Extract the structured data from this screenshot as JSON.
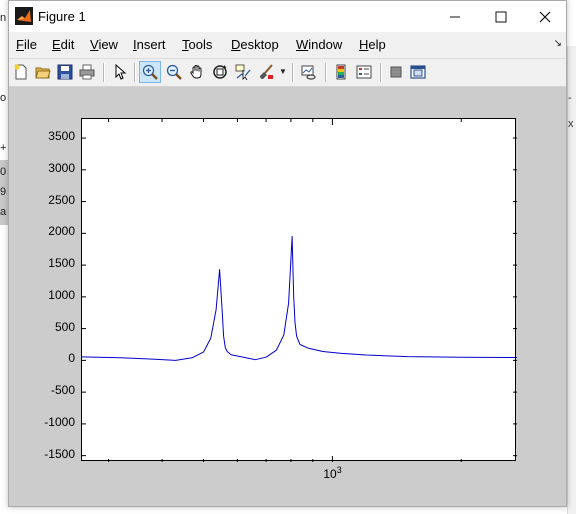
{
  "window": {
    "title": "Figure 1",
    "controls": {
      "minimize": "minimize",
      "maximize": "maximize",
      "close": "close"
    }
  },
  "menu": {
    "items": [
      "File",
      "Edit",
      "View",
      "Insert",
      "Tools",
      "Desktop",
      "Window",
      "Help"
    ],
    "overflow_arrow": "↘"
  },
  "toolbar": {
    "buttons": [
      "new-figure-icon",
      "open-file-icon",
      "save-icon",
      "print-icon",
      "edit-plot-arrow-icon",
      "zoom-in-icon",
      "zoom-out-icon",
      "pan-hand-icon",
      "rotate-3d-icon",
      "data-cursor-icon",
      "brush-icon",
      "link-plot-icon",
      "colorbar-icon",
      "legend-icon",
      "hide-plot-tools-icon",
      "show-plot-tools-icon"
    ],
    "active": "zoom-in-icon"
  },
  "background_app": {
    "left_fragments": [
      "n",
      "o",
      "+",
      "0",
      "9",
      "a"
    ],
    "right_fragments": [
      "-",
      "x"
    ]
  },
  "chart_data": {
    "type": "line",
    "x_scale": "log",
    "xlim": [
      260,
      2700
    ],
    "ylim": [
      -1600,
      3800
    ],
    "yticks": [
      3500,
      3000,
      2500,
      2000,
      1500,
      1000,
      500,
      0,
      -500,
      -1000,
      -1500
    ],
    "xticks": [
      {
        "value": 1000,
        "label_base": "10",
        "label_exp": "3"
      }
    ],
    "grid": false,
    "series": [
      {
        "color": "#0000cc",
        "x": [
          260,
          320,
          380,
          430,
          470,
          500,
          520,
          535,
          545,
          552,
          557,
          562,
          568,
          580,
          610,
          660,
          700,
          740,
          770,
          790,
          805,
          812,
          818,
          825,
          840,
          880,
          950,
          1050,
          1200,
          1500,
          2000,
          2700
        ],
        "y": [
          55,
          40,
          20,
          0,
          40,
          130,
          350,
          800,
          1430,
          850,
          380,
          200,
          140,
          90,
          60,
          10,
          50,
          160,
          400,
          900,
          1950,
          1000,
          600,
          380,
          250,
          190,
          140,
          110,
          85,
          60,
          50,
          45
        ]
      }
    ]
  }
}
